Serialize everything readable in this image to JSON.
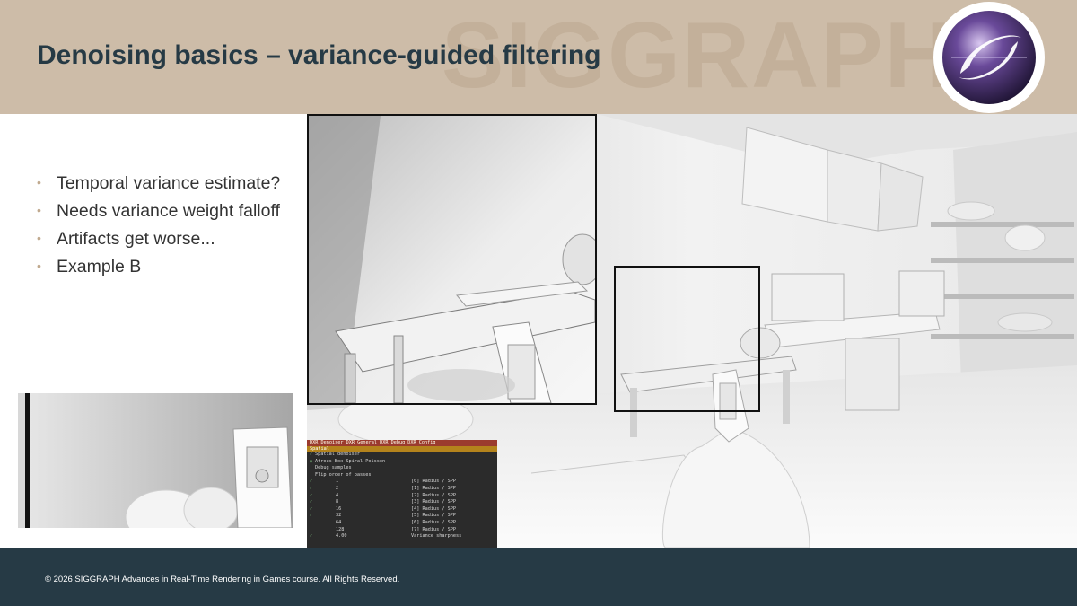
{
  "slide": {
    "title": "Denoising basics – variance-guided filtering",
    "watermark": "SIGGRAPH",
    "bullets": [
      "Temporal variance estimate?",
      "Needs variance weight falloff",
      "Artifacts get worse...",
      "Example B"
    ],
    "footer": "© 2026 SIGGRAPH Advances in Real-Time Rendering in Games course. All Rights Reserved."
  },
  "colors": {
    "header_bg": "#cdbca8",
    "title": "#263a45",
    "bullet_dot": "#c0a98e",
    "footer_bg": "#263a45"
  },
  "debug_panel": {
    "tabs": "DXR Denoiser  DXR General  DXR Debug  DXR Config",
    "section": "Spatial",
    "rows": [
      {
        "check": "✓",
        "value": "",
        "label": "Spatial denoiser"
      },
      {
        "check": "◉",
        "value": "",
        "label": "Atrous   Box   Spiral   Poisson"
      },
      {
        "check": "",
        "value": "",
        "label": "Debug samples"
      },
      {
        "check": "",
        "value": "",
        "label": "Flip order of passes"
      },
      {
        "check": "✓",
        "value": "1",
        "label": "[0] Radius / SPP"
      },
      {
        "check": "✓",
        "value": "2",
        "label": "[1] Radius / SPP"
      },
      {
        "check": "✓",
        "value": "4",
        "label": "[2] Radius / SPP"
      },
      {
        "check": "✓",
        "value": "8",
        "label": "[3] Radius / SPP"
      },
      {
        "check": "✓",
        "value": "16",
        "label": "[4] Radius / SPP"
      },
      {
        "check": "✓",
        "value": "32",
        "label": "[5] Radius / SPP"
      },
      {
        "check": "",
        "value": "64",
        "label": "[6] Radius / SPP"
      },
      {
        "check": "",
        "value": "128",
        "label": "[7] Radius / SPP"
      },
      {
        "check": "✓",
        "value": "4.00",
        "label": "Variance sharpness"
      }
    ]
  },
  "icons": [
    "siggraph-logo-icon"
  ]
}
